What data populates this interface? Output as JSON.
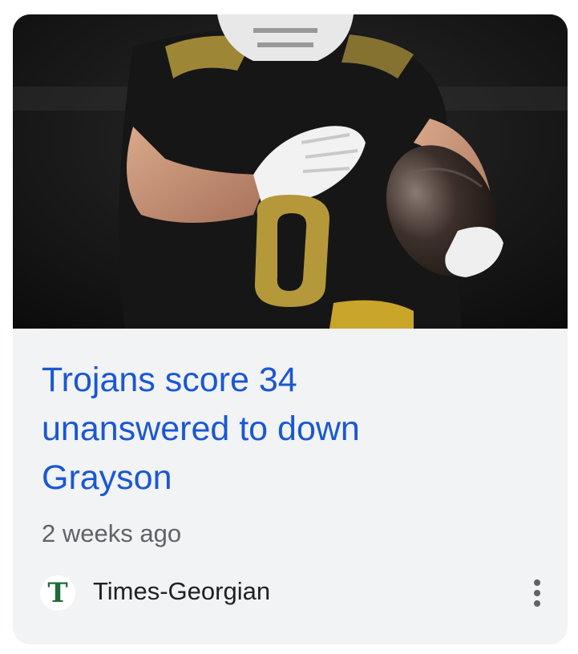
{
  "article": {
    "headline": "Trojans score 34 unanswered to down Grayson",
    "time_ago": "2 weeks ago",
    "source": {
      "name": "Times-Georgian",
      "favicon_letter": "T"
    },
    "image_icon": "football-player-photo"
  },
  "menu": {
    "icon": "more-vert-icon"
  },
  "colors": {
    "headline": "#1a57d4",
    "card_background": "#f1f3f4",
    "meta_text": "#5f6368",
    "favicon_green": "#1f6b3a"
  }
}
